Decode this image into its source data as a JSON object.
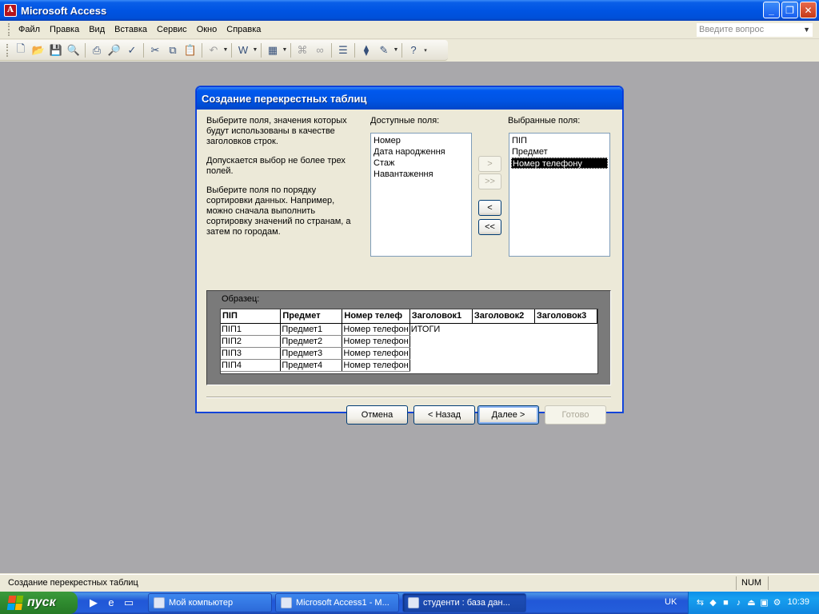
{
  "app": {
    "title": "Microsoft Access",
    "icon_letter": "A"
  },
  "window_buttons": {
    "minimize": "_",
    "restore": "❐",
    "close": "✕"
  },
  "menu": {
    "items": [
      {
        "label": "Файл",
        "hotkey": "Ф"
      },
      {
        "label": "Правка",
        "hotkey": "П"
      },
      {
        "label": "Вид",
        "hotkey": "В"
      },
      {
        "label": "Вставка",
        "hotkey": "с"
      },
      {
        "label": "Сервис",
        "hotkey": "С"
      },
      {
        "label": "Окно",
        "hotkey": "О"
      },
      {
        "label": "Справка",
        "hotkey": "С"
      }
    ],
    "ask_placeholder": "Введите вопрос"
  },
  "toolbar": {
    "icons": [
      "new-icon",
      "open-icon",
      "save-icon",
      "search-icon",
      "print-icon",
      "print-preview-icon",
      "spelling-icon",
      "cut-icon",
      "copy-icon",
      "paste-icon",
      "undo-icon",
      "office-links-icon",
      "analyze-icon",
      "code-icon",
      "relationships-icon",
      "properties-icon",
      "new-object-icon",
      "help-icon"
    ]
  },
  "dialog": {
    "title": "Создание перекрестных таблиц",
    "hint1": "Выберите поля, значения которых будут использованы в качестве заголовков строк.",
    "hint2": "Допускается выбор не более трех полей.",
    "hint3": "Выберите поля по порядку сортировки данных. Например, можно сначала выполнить сортировку значений по странам, а затем по городам.",
    "available_label": "Доступные поля:",
    "available_fields": [
      "Номер",
      "Дата народження",
      "Стаж",
      "Навантаження"
    ],
    "selected_label": "Выбранные поля:",
    "selected_fields": [
      "ПІП",
      "Предмет",
      "Номер телефону"
    ],
    "selected_index": 2,
    "move_buttons": {
      "add": ">",
      "add_all": ">>",
      "remove": "<",
      "remove_all": "<<"
    },
    "sample_label": "Образец:",
    "sample_headers": [
      "ПІП",
      "Предмет",
      "Номер телеф",
      "Заголовок1",
      "Заголовок2",
      "Заголовок3"
    ],
    "sample_rows": [
      [
        "ПІП1",
        "Предмет1",
        "Номер телефон",
        "ИТОГИ"
      ],
      [
        "ПІП2",
        "Предмет2",
        "Номер телефон"
      ],
      [
        "ПІП3",
        "Предмет3",
        "Номер телефон"
      ],
      [
        "ПІП4",
        "Предмет4",
        "Номер телефон"
      ]
    ],
    "buttons": {
      "cancel": "Отмена",
      "back": "< Назад",
      "next": "Далее >",
      "finish": "Готово"
    }
  },
  "status": {
    "text": "Создание перекрестных таблиц",
    "num": "NUM"
  },
  "taskbar": {
    "start_label": "пуск",
    "tasks": [
      {
        "label": "Мой компьютер",
        "active": false
      },
      {
        "label": "Microsoft Access1 - M...",
        "active": false
      },
      {
        "label": "студенти : база дан...",
        "active": true
      }
    ],
    "language": "UK",
    "clock": "10:39"
  },
  "colors": {
    "title_blue": "#0054e3",
    "workspace_gray": "#a9a8ab",
    "dialog_bg": "#ece9d8",
    "selection": "#000000"
  }
}
